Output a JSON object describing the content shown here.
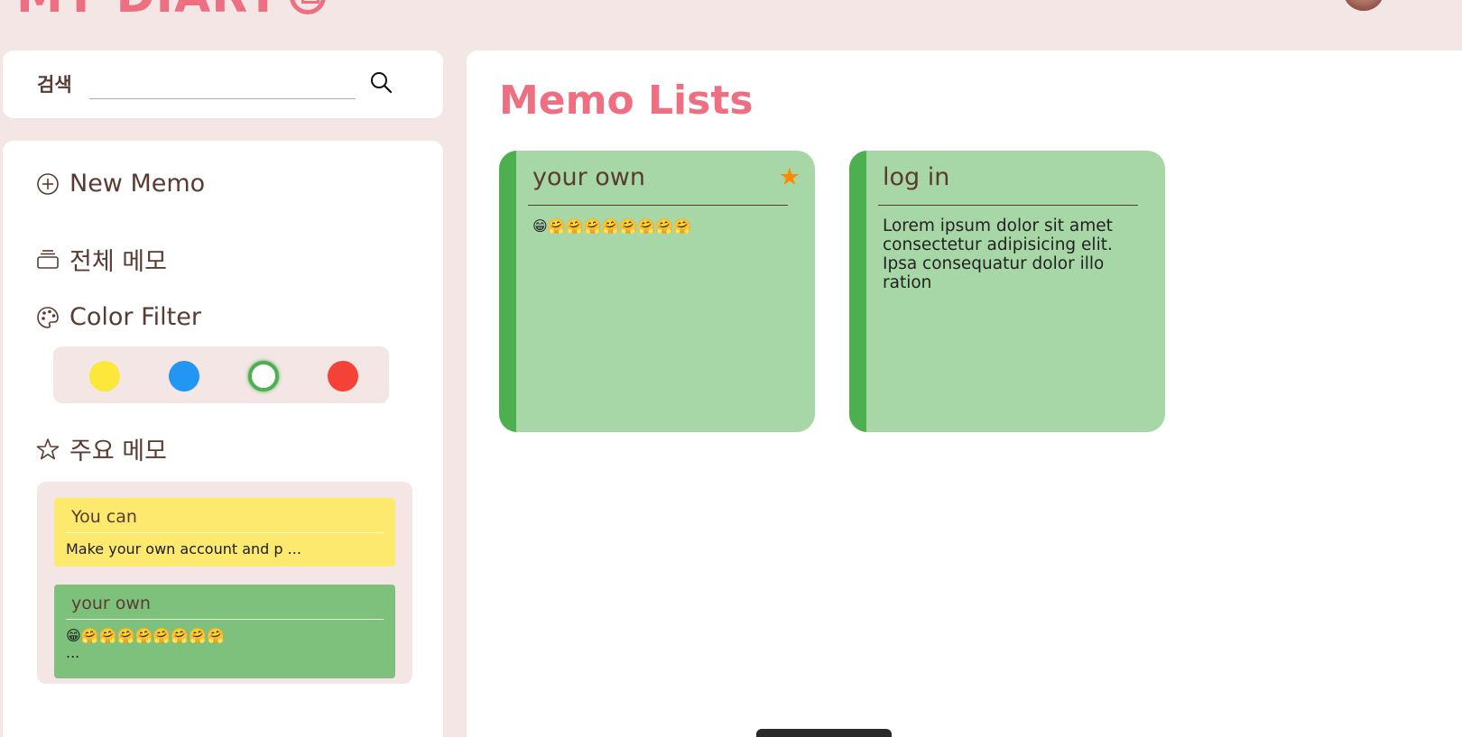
{
  "header": {
    "brand": "MY DIARY",
    "brand_icon": "diary-icon",
    "avatar_icon": "user-avatar"
  },
  "search": {
    "label": "검색",
    "value": "",
    "placeholder": "",
    "icon": "search-icon"
  },
  "sidebar": {
    "new_memo": "New Memo",
    "all_memos": "전체 메모",
    "color_filter": "Color Filter",
    "important_memos": "주요 메모",
    "colors": [
      {
        "name": "yellow",
        "hex": "#fce83a"
      },
      {
        "name": "blue",
        "hex": "#2196f3"
      },
      {
        "name": "green",
        "hex": "#4caf50",
        "selected": true
      },
      {
        "name": "red",
        "hex": "#f44336"
      }
    ],
    "important": [
      {
        "title": "You can",
        "body": "Make your own account and p ...",
        "color": "#fce96e"
      },
      {
        "title": "your own",
        "body": "😁🤗🤗🤗🤗🤗🤗🤗🤗",
        "more": "...",
        "color": "#7dc17c"
      }
    ]
  },
  "main": {
    "title": "Memo Lists",
    "memos": [
      {
        "title": "your own",
        "body": "😁🤗🤗🤗🤗🤗🤗🤗🤗",
        "starred": true,
        "color": "#a7d7a6",
        "accent": "#4caf50"
      },
      {
        "title": "log in",
        "body": "Lorem ipsum dolor sit amet consectetur adipisicing elit. Ipsa consequatur dolor illo ration",
        "starred": false,
        "color": "#a7d7a6",
        "accent": "#4caf50"
      }
    ],
    "star_glyph": "★"
  },
  "colors": {
    "brand": "#ee6f82",
    "background": "#f3e6e4",
    "text": "#5a3b32",
    "star": "#ff8a00"
  }
}
